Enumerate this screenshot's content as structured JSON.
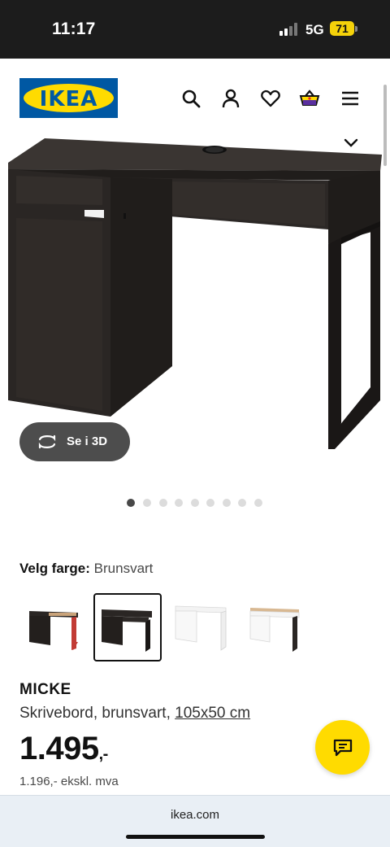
{
  "status_bar": {
    "time": "11:17",
    "network": "5G",
    "battery": "71"
  },
  "header": {
    "logo_text": "IKEA",
    "icons": [
      "search-icon",
      "account-icon",
      "heart-icon",
      "basket-icon",
      "menu-icon"
    ]
  },
  "gallery": {
    "view_3d_label": "Se i 3D",
    "image_count": 9,
    "active_index": 0
  },
  "color": {
    "label": "Velg farge:",
    "value": "Brunsvart",
    "options": [
      "black-brown with red",
      "brunsvart",
      "white",
      "white and oak"
    ],
    "selected_index": 1
  },
  "product": {
    "name": "MICKE",
    "description": "Skrivebord, brunsvart,",
    "size": "105x50 cm",
    "price": "1.495",
    "price_suffix": ",-",
    "price_ex_vat": "1.196,- ekskl. mva"
  },
  "browser": {
    "url": "ikea.com"
  },
  "colors": {
    "brand_blue": "#0058a3",
    "brand_yellow": "#ffdb00",
    "desk": "#2a2624"
  }
}
